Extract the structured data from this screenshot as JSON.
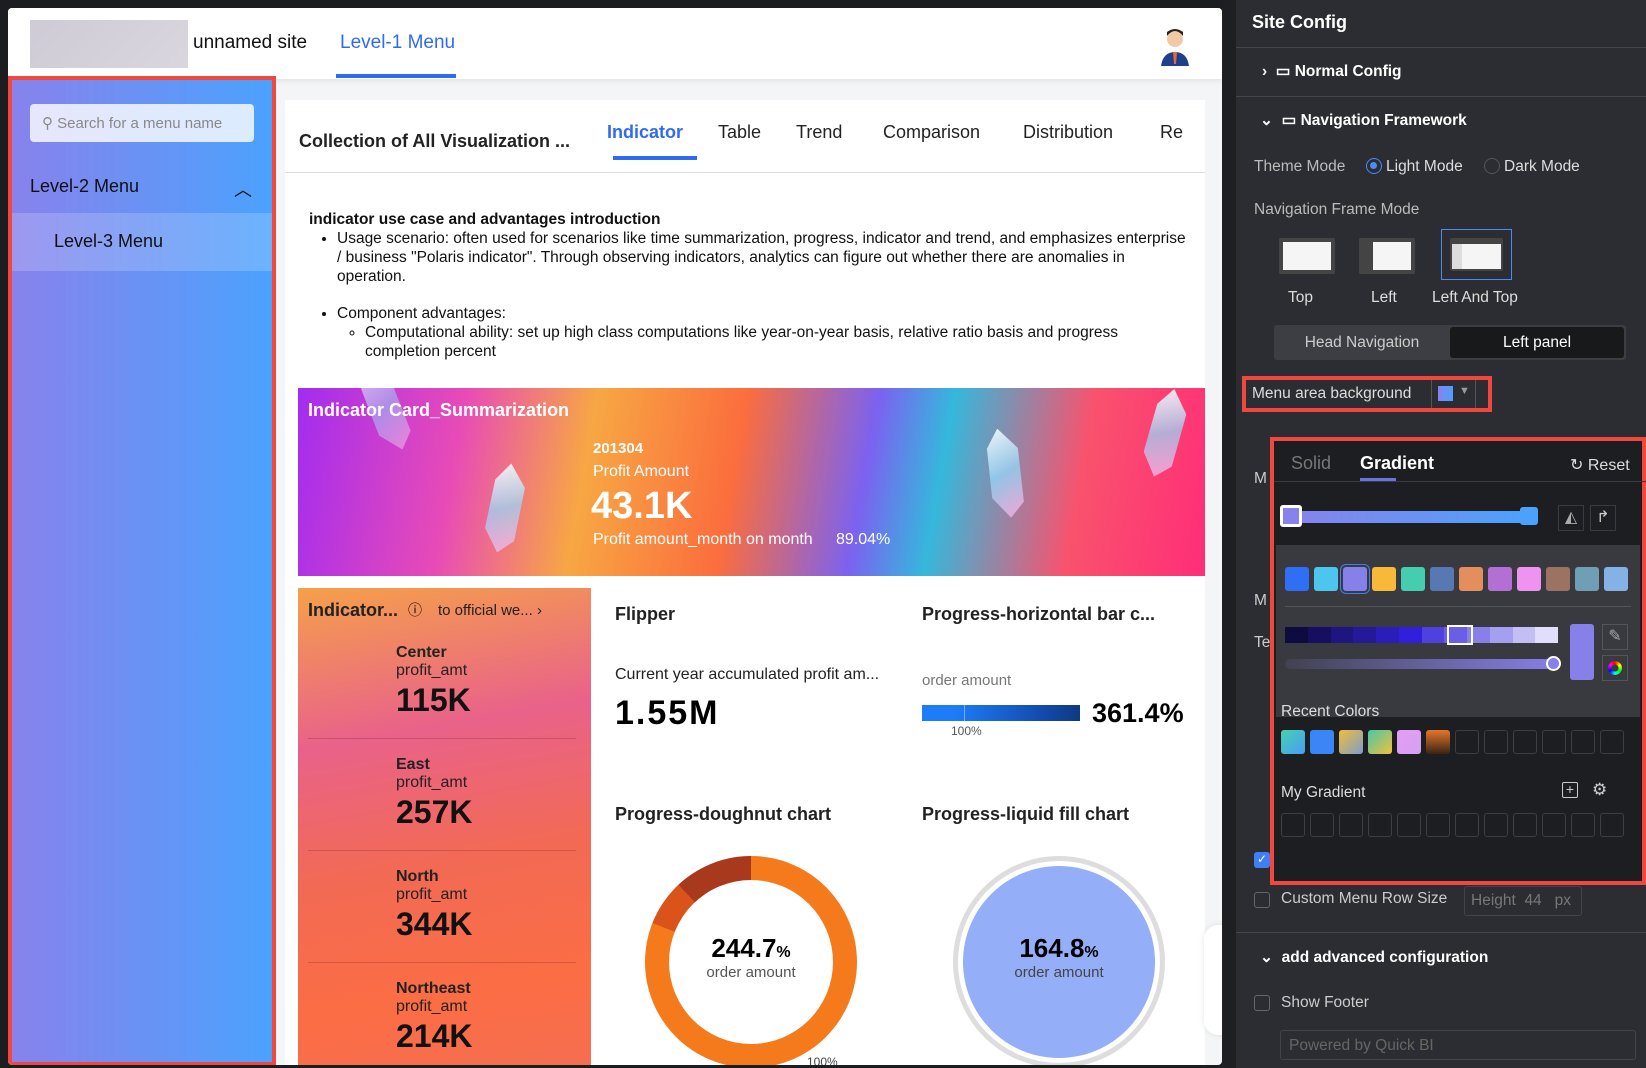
{
  "header": {
    "site_name": "unnamed site",
    "level1_menu": "Level-1 Menu"
  },
  "sidebar": {
    "search_placeholder": "Search for a menu name",
    "level2": "Level-2 Menu",
    "level3": "Level-3 Menu",
    "background_start": "#8882ec",
    "background_end": "#4ba2fd"
  },
  "content": {
    "title": "Collection of All Visualization ...",
    "tabs": [
      "Indicator",
      "Table",
      "Trend",
      "Comparison",
      "Distribution",
      "Re"
    ],
    "active_tab": "Indicator",
    "intro": {
      "heading": "indicator use case and advantages introduction",
      "usage": "Usage scenario: often used for scenarios like time summarization, progress, indicator and trend, and emphasizes enterprise / business \"Polaris indicator\". Through observing indicators, analytics can figure out whether there are anomalies in operation.",
      "advantages": "Component advantages:",
      "computational": "Computational ability: set up high class computations like year-on-year basis, relative ratio basis and progress completion percent"
    },
    "banner": {
      "title": "Indicator Card_Summarization",
      "period": "201304",
      "label": "Profit Amount",
      "value": "43.1K",
      "mom_label": "Profit amount_month on month",
      "mom_value": "89.04%"
    },
    "indicator_list": {
      "title": "Indicator...",
      "link": "to official we...",
      "regions": [
        {
          "name": "Center",
          "metric": "profit_amt",
          "value": "115K"
        },
        {
          "name": "East",
          "metric": "profit_amt",
          "value": "257K"
        },
        {
          "name": "North",
          "metric": "profit_amt",
          "value": "344K"
        },
        {
          "name": "Northeast",
          "metric": "profit_amt",
          "value": "214K"
        }
      ]
    },
    "flipper": {
      "title": "Flipper",
      "label": "Current year accumulated profit am...",
      "value": "1.55M"
    },
    "progress_bar": {
      "title": "Progress-horizontal bar c...",
      "label": "order amount",
      "value": "361.4%",
      "marker": "100%",
      "progress": 3.614
    },
    "doughnut": {
      "title": "Progress-doughnut chart",
      "value": "244.7",
      "unit": "%",
      "label": "order amount",
      "marker": "100%",
      "progress": 2.447
    },
    "liquid": {
      "title": "Progress-liquid fill chart",
      "value": "164.8",
      "unit": "%",
      "label": "order amount",
      "progress": 1.648
    }
  },
  "panel": {
    "title": "Site Config",
    "normal_config": "Normal Config",
    "nav_framework": "Navigation Framework",
    "theme_mode": "Theme Mode",
    "light": "Light Mode",
    "dark": "Dark Mode",
    "frame_mode": "Navigation Frame Mode",
    "frames": [
      "Top",
      "Left",
      "Left And Top"
    ],
    "selected_frame": "Left And Top",
    "segments": [
      "Head Navigation",
      "Left panel"
    ],
    "active_segment": "Left panel",
    "menu_bg": "Menu area background",
    "hidden_m1": "M",
    "hidden_m2": "M",
    "hidden_te": "Te",
    "custom_row": "Custom Menu Row Size",
    "height_label": "Height",
    "height_value": "44",
    "height_unit": "px",
    "advanced": "add advanced configuration",
    "show_footer": "Show Footer",
    "footer_placeholder": "Powered by Quick BI"
  },
  "picker": {
    "tabs": [
      "Solid",
      "Gradient"
    ],
    "active": "Gradient",
    "reset": "Reset",
    "gradient_start": "#8882ec",
    "gradient_end": "#4ba2fd",
    "swatches": [
      "#2f6ff5",
      "#4dc6ef",
      "#8880e9",
      "#f8b93b",
      "#45cdb0",
      "#5878b4",
      "#e48e5d",
      "#b46fd5",
      "#ef93f0",
      "#9c7362",
      "#6f9fb4",
      "#85b2e6"
    ],
    "shades": [
      "#0e0b40",
      "#160f60",
      "#1f1580",
      "#25199a",
      "#2a1dba",
      "#321fdc",
      "#4f40e0",
      "#6b5ee6",
      "#8880e9",
      "#a59ff0",
      "#c3bff5",
      "#e0def9"
    ],
    "selected_color": "#8880e9",
    "recent_label": "Recent Colors",
    "recent": [
      "linear-gradient(135deg,#45d1b0,#4a9cf5)",
      "#3a86f7",
      "linear-gradient(135deg,#f2bd3c,#7d9ec9)",
      "linear-gradient(135deg,#48c7a8,#f2c03c)",
      "linear-gradient(135deg,#e39ef5,#d6a0f0)",
      "linear-gradient(180deg,#e5762a,#3a2416)"
    ],
    "my_gradient": "My Gradient"
  }
}
